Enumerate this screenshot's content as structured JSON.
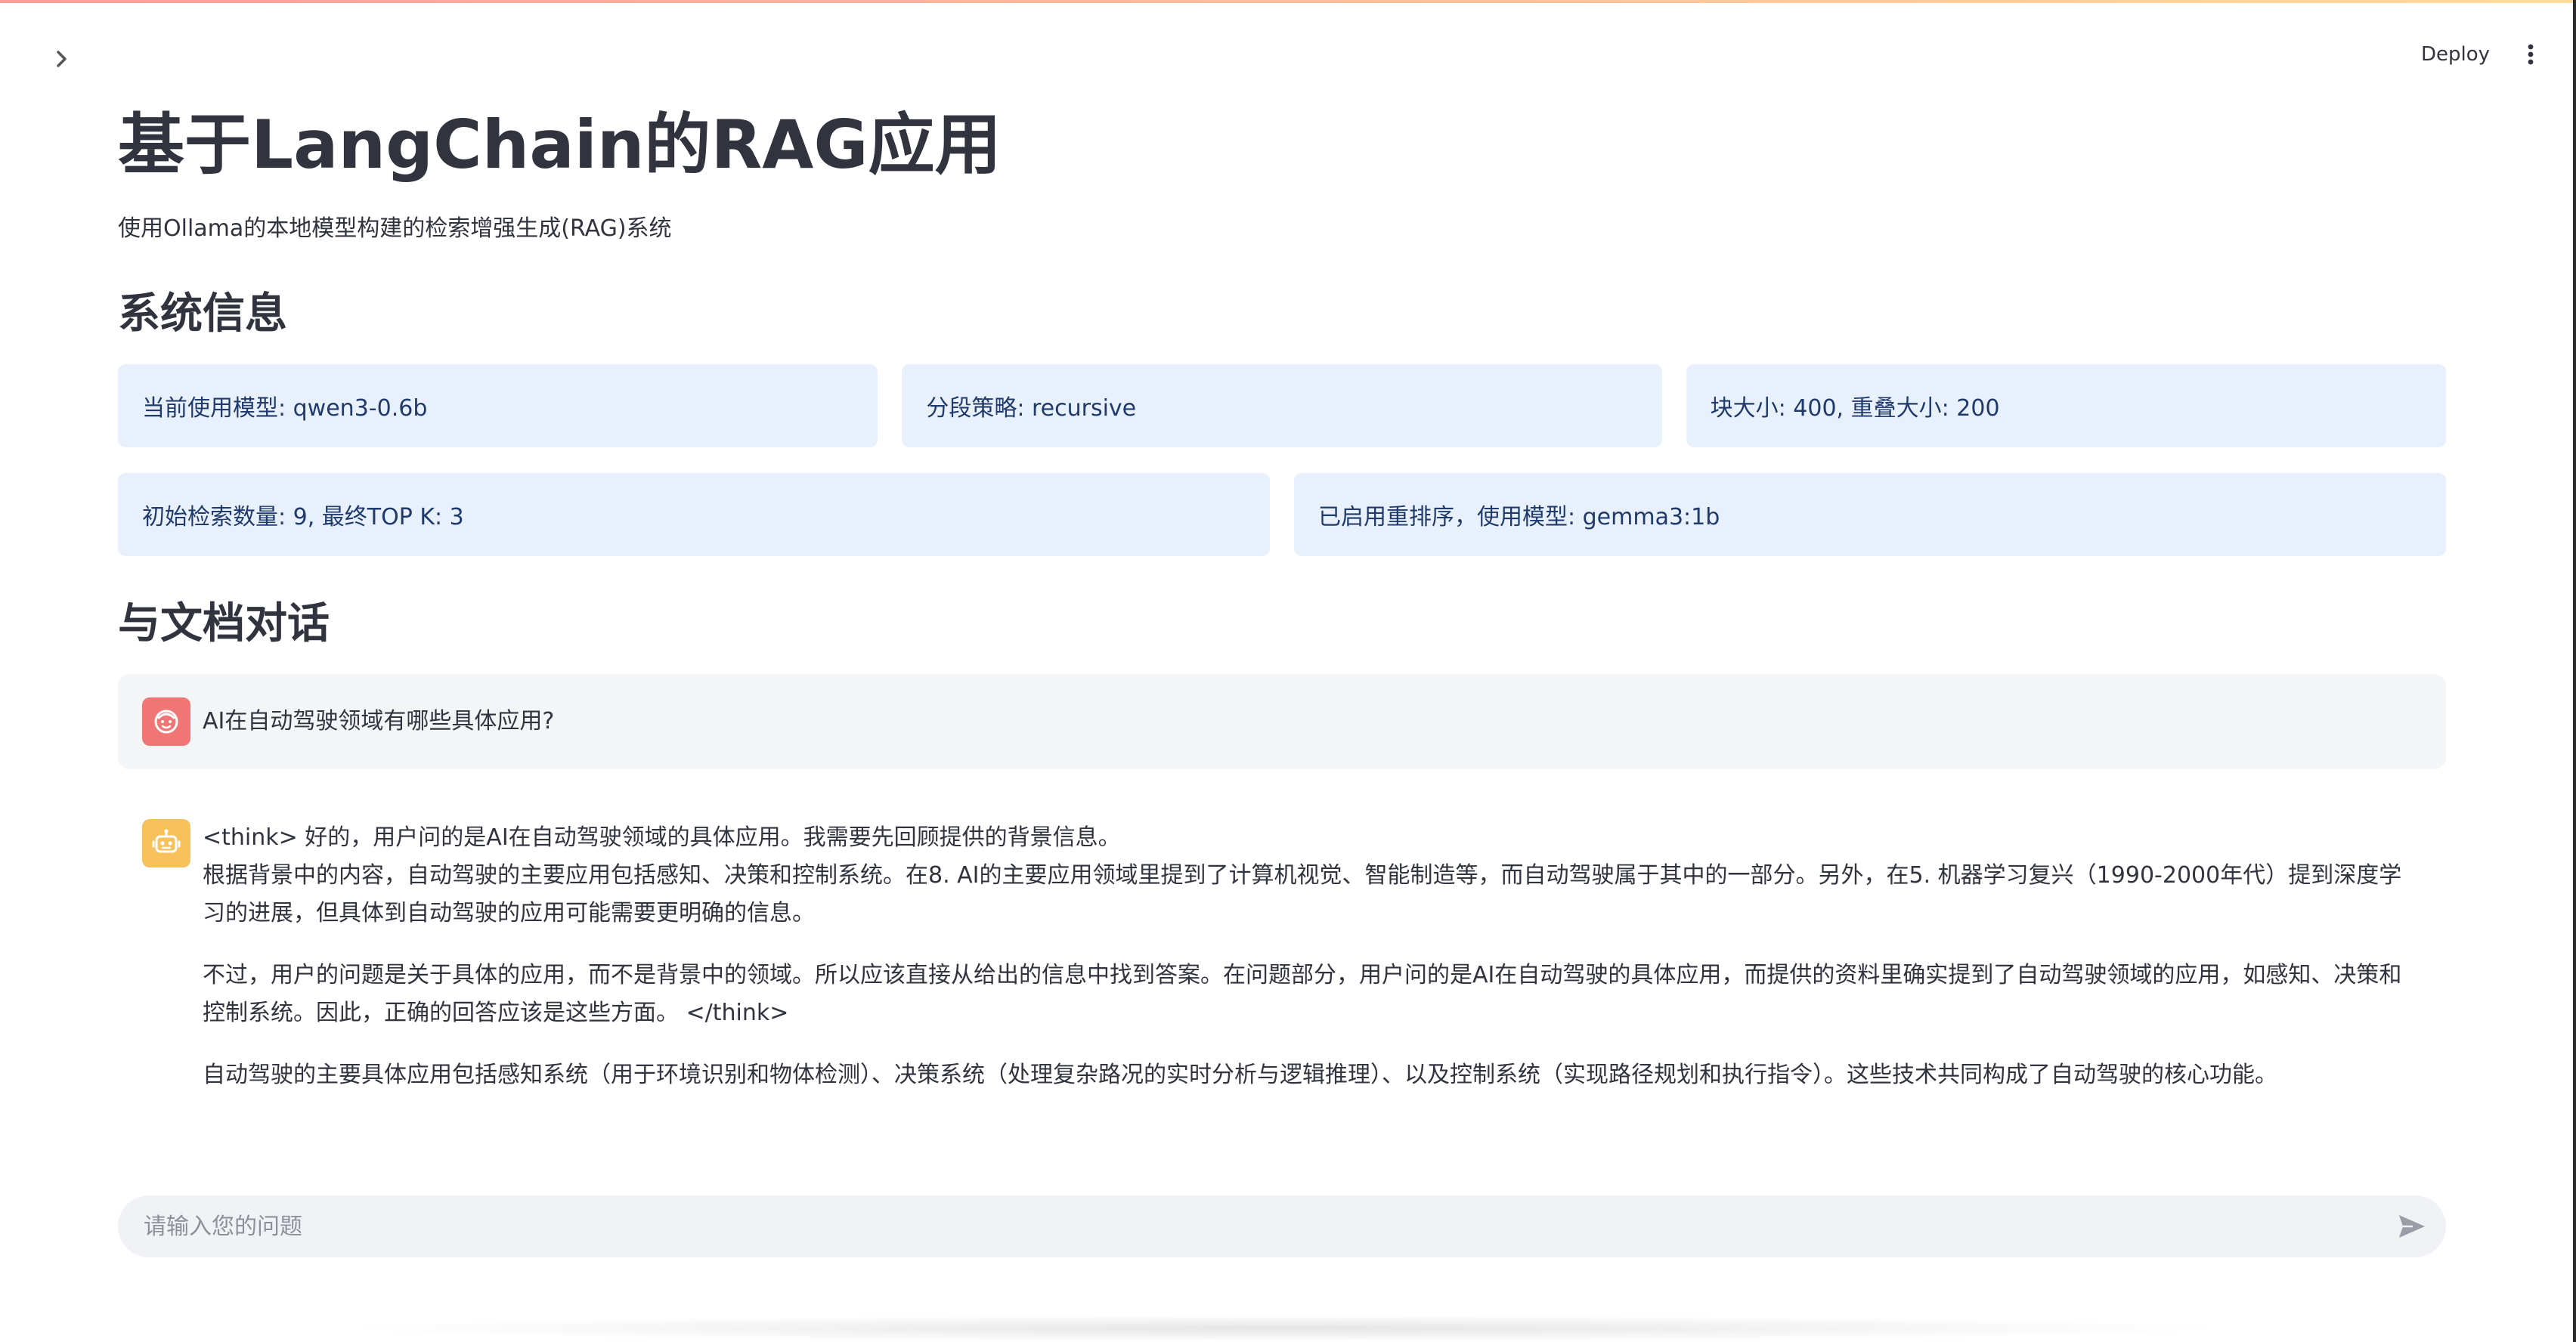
{
  "header": {
    "deploy_label": "Deploy",
    "sidebar_toggle_icon": "chevron-right-icon",
    "menu_icon": "vertical-ellipsis-icon"
  },
  "page": {
    "title": "基于LangChain的RAG应用",
    "subtitle": "使用Ollama的本地模型构建的检索增强生成(RAG)系统"
  },
  "system_info": {
    "heading": "系统信息",
    "row1": [
      "当前使用模型: qwen3-0.6b",
      "分段策略: recursive",
      "块大小: 400, 重叠大小: 200"
    ],
    "row2": [
      "初始检索数量: 9, 最终TOP K: 3",
      "已启用重排序，使用模型: gemma3:1b"
    ]
  },
  "chat": {
    "heading": "与文档对话",
    "messages": [
      {
        "role": "user",
        "avatar_icon": "user-face-icon",
        "text": "AI在自动驾驶领域有哪些具体应用?"
      },
      {
        "role": "assistant",
        "avatar_icon": "robot-icon",
        "paragraphs": [
          "<think> 好的，用户问的是AI在自动驾驶领域的具体应用。我需要先回顾提供的背景信息。",
          "根据背景中的内容，自动驾驶的主要应用包括感知、决策和控制系统。在8. AI的主要应用领域里提到了计算机视觉、智能制造等，而自动驾驶属于其中的一部分。另外，在5. 机器学习复兴（1990-2000年代）提到深度学习的进展，但具体到自动驾驶的应用可能需要更明确的信息。",
          "不过，用户的问题是关于具体的应用，而不是背景中的领域。所以应该直接从给出的信息中找到答案。在问题部分，用户问的是AI在自动驾驶的具体应用，而提供的资料里确实提到了自动驾驶领域的应用，如感知、决策和控制系统。因此，正确的回答应该是这些方面。 </think>",
          "自动驾驶的主要具体应用包括感知系统（用于环境识别和物体检测）、决策系统（处理复杂路况的实时分析与逻辑推理）、以及控制系统（实现路径规划和执行指令）。这些技术共同构成了自动驾驶的核心功能。"
        ]
      }
    ],
    "input": {
      "placeholder": "请输入您的问题",
      "value": "",
      "send_icon": "send-icon"
    }
  },
  "colors": {
    "info_box_bg": "#e8f0fc",
    "info_box_text": "#1f3a6b",
    "user_avatar": "#f07575",
    "bot_avatar": "#f7c25c",
    "input_bg": "#f0f2f6"
  }
}
